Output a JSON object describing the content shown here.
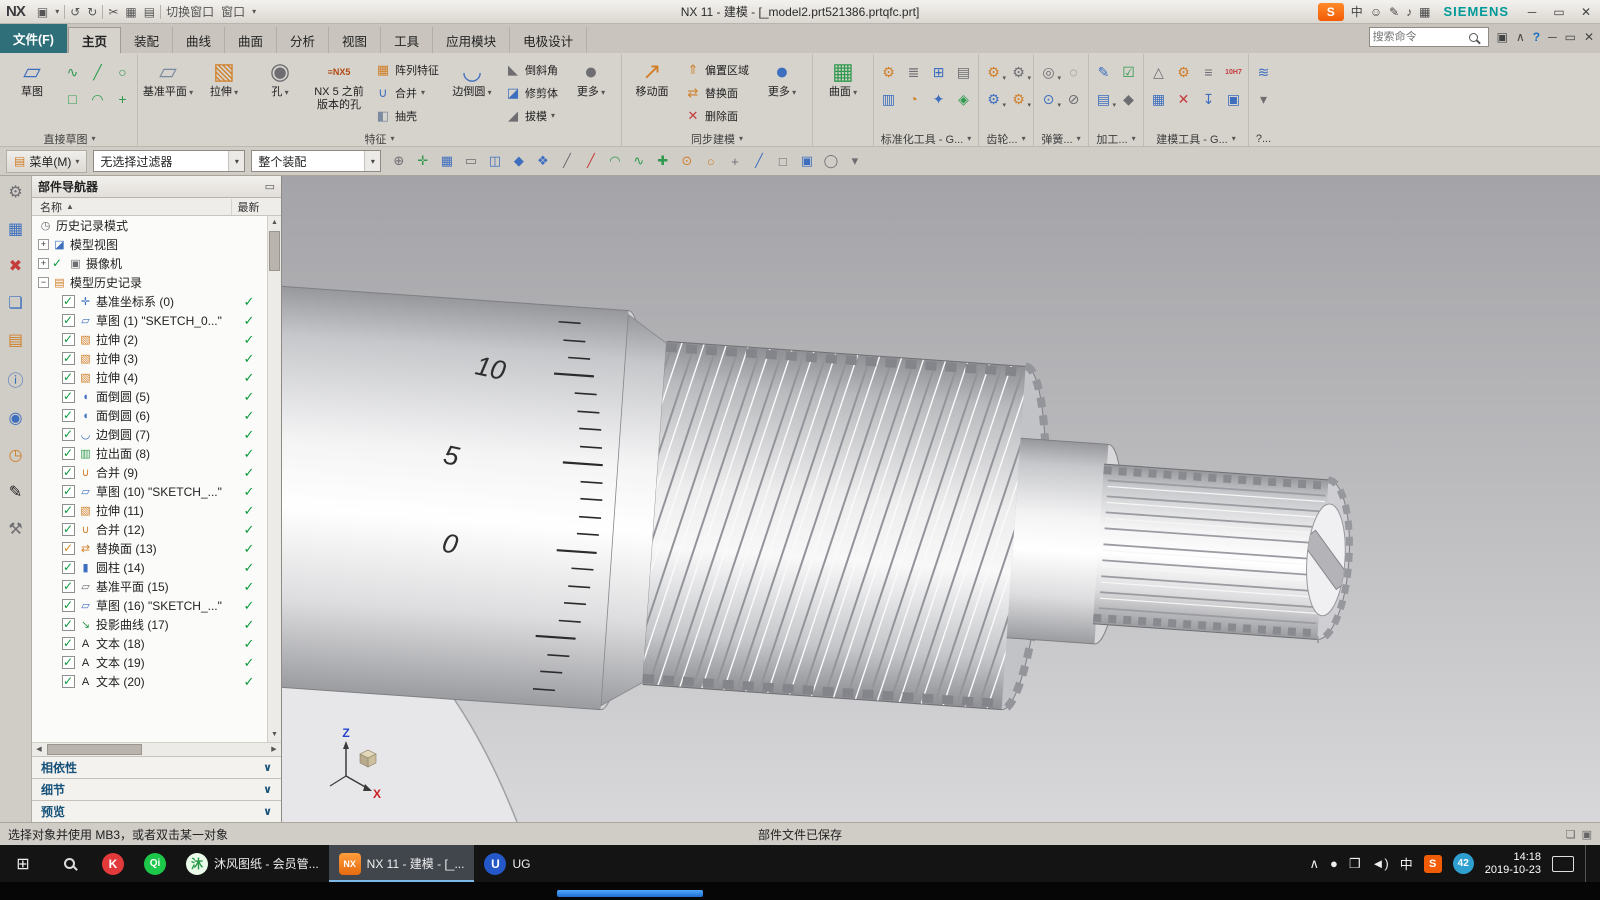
{
  "titlebar": {
    "logo": "NX",
    "title": "NX 11 - 建模 - [_model2.prt521386.prtqfc.prt]",
    "switch_window": "切换窗口",
    "window": "窗口",
    "ime_sogou": "S",
    "ime_lang": "中",
    "brand": "SIEMENS"
  },
  "tabs": {
    "search_placeholder": "搜索命令",
    "items": [
      {
        "label": "文件(F)",
        "c": "t-file"
      },
      {
        "label": "主页",
        "c": "t-active"
      },
      {
        "label": "装配",
        "c": ""
      },
      {
        "label": "曲线",
        "c": ""
      },
      {
        "label": "曲面",
        "c": ""
      },
      {
        "label": "分析",
        "c": ""
      },
      {
        "label": "视图",
        "c": ""
      },
      {
        "label": "工具",
        "c": ""
      },
      {
        "label": "应用模块",
        "c": ""
      },
      {
        "label": "电极设计",
        "c": ""
      }
    ]
  },
  "ribbon": {
    "more": "更多",
    "sketch": {
      "label": "直接草图",
      "main": "草图",
      "tools": [
        {
          "g": "∿",
          "c": "c-grn"
        },
        {
          "g": "□",
          "c": "c-grn"
        },
        {
          "g": "╱",
          "c": "c-grn"
        },
        {
          "g": "◠",
          "c": "c-grn"
        },
        {
          "g": "○",
          "c": "c-grn"
        },
        {
          "g": "+",
          "c": "c-grn"
        }
      ]
    },
    "feature": {
      "label": "特征",
      "datum": "基准平面",
      "extrude": "拉伸",
      "hole": "孔",
      "nx5_icon": "≡NX5",
      "nx5": "NX 5 之前版本的孔",
      "pattern": "阵列特征",
      "unite": "合并",
      "shell": "抽壳",
      "blend": "边倒圆",
      "chamfer": "倒斜角",
      "trim": "修剪体",
      "draft": "拔模"
    },
    "sync": {
      "label": "同步建模",
      "move": "移动面",
      "offset": "偏置区域",
      "replace": "替换面",
      "del": "删除面"
    },
    "surface": {
      "main": "曲面"
    },
    "std": {
      "label": "标准化工具 - G...",
      "icons": [
        {
          "g": "⚙",
          "c": "c-org"
        },
        {
          "g": "▥",
          "c": "c-blu"
        },
        {
          "g": "≣",
          "c": "c-gry"
        },
        {
          "g": "◔",
          "c": "c-org"
        },
        {
          "g": "⊞",
          "c": "c-blu"
        },
        {
          "g": "✦",
          "c": "c-blu"
        },
        {
          "g": "▤",
          "c": "c-gry"
        },
        {
          "g": "◈",
          "c": "c-grn"
        }
      ]
    },
    "gear": {
      "label": "齿轮...",
      "icons": [
        {
          "g": "⚙",
          "c": "c-org dd"
        },
        {
          "g": "⚙",
          "c": "c-blu dd"
        },
        {
          "g": "⚙",
          "c": "c-gry dd"
        },
        {
          "g": "⚙",
          "c": "c-org dd"
        }
      ]
    },
    "spring": {
      "label": "弹簧...",
      "icons": [
        {
          "g": "◎",
          "c": "c-gry dd"
        },
        {
          "g": "⊙",
          "c": "c-blu dd"
        },
        {
          "g": "◌",
          "c": "c-gry"
        },
        {
          "g": "⊘",
          "c": "c-gry"
        }
      ]
    },
    "mach": {
      "label": "加工...",
      "icons": [
        {
          "g": "✎",
          "c": "c-blu"
        },
        {
          "g": "▤",
          "c": "c-blu dd"
        },
        {
          "g": "☑",
          "c": "c-grn"
        },
        {
          "g": "◆",
          "c": "c-gry"
        }
      ]
    },
    "mtools": {
      "label": "建模工具 - G...",
      "icons": [
        {
          "g": "△",
          "c": "c-gry"
        },
        {
          "g": "▦",
          "c": "c-blu"
        },
        {
          "g": "⚙",
          "c": "c-org"
        },
        {
          "g": "✕",
          "c": "c-red"
        },
        {
          "g": "≡",
          "c": "c-gry"
        },
        {
          "g": "↧",
          "c": "c-blu"
        },
        {
          "g": "10H7",
          "c": "c-red txt"
        },
        {
          "g": "▣",
          "c": "c-blu"
        }
      ]
    },
    "extra": {
      "label": "?...",
      "icons": [
        {
          "g": "≋",
          "c": "c-blu"
        },
        {
          "g": "▾",
          "c": "c-gry"
        }
      ]
    }
  },
  "selbar": {
    "menu": "菜单(M)",
    "filter": "无选择过滤器",
    "scope": "整个装配",
    "icons": [
      {
        "g": "⊕",
        "c": "c-gry"
      },
      {
        "g": "✛",
        "c": "c-grn"
      },
      {
        "g": "▦",
        "c": "c-blu"
      },
      {
        "g": "▭",
        "c": "c-gry"
      },
      {
        "g": "◫",
        "c": "c-blu"
      },
      {
        "g": "◆",
        "c": "c-blu"
      },
      {
        "g": "❖",
        "c": "c-blu"
      },
      {
        "g": "╱",
        "c": "c-gry"
      },
      {
        "g": "╱",
        "c": "c-red"
      },
      {
        "g": "◠",
        "c": "c-grn"
      },
      {
        "g": "∿",
        "c": "c-grn"
      },
      {
        "g": "✚",
        "c": "c-grn"
      },
      {
        "g": "⊙",
        "c": "c-org"
      },
      {
        "g": "○",
        "c": "c-org"
      },
      {
        "g": "+",
        "c": "c-gry"
      },
      {
        "g": "╱",
        "c": "c-blu"
      },
      {
        "g": "□",
        "c": "c-gry"
      },
      {
        "g": "▣",
        "c": "c-blu"
      },
      {
        "g": "◯",
        "c": "c-gry"
      },
      {
        "g": "▾",
        "c": "c-gry"
      }
    ]
  },
  "leftstrip": {
    "icons": [
      {
        "g": "⚙",
        "c": "c-gry"
      },
      {
        "g": "▦",
        "c": "c-blu"
      },
      {
        "g": "✖",
        "c": "c-red"
      },
      {
        "g": "❏",
        "c": "c-blu"
      },
      {
        "g": "▤",
        "c": "c-org"
      },
      {
        "g": "ⓘ",
        "c": "c-blu"
      },
      {
        "g": "◉",
        "c": "c-blu"
      },
      {
        "g": "◷",
        "c": "c-org"
      },
      {
        "g": "✎",
        "c": "c-blk"
      },
      {
        "g": "⚒",
        "c": "c-gry"
      }
    ]
  },
  "navigator": {
    "title": "部件导航器",
    "col_name": "名称",
    "col_latest": "最新",
    "rows": [
      {
        "c": "lvl0",
        "exp": "",
        "cb": "",
        "icc": "c-gry",
        "icg": "◷",
        "label": "历史记录模式",
        "lat": ""
      },
      {
        "c": "lvl0",
        "exp": "+",
        "cb": "",
        "icc": "c-blu",
        "icg": "◪",
        "label": "模型视图",
        "lat": ""
      },
      {
        "c": "lvl0",
        "exp": "+",
        "cb": "cb-mark",
        "icc": "c-gry",
        "icg": "▣",
        "label": "摄像机",
        "lat": ""
      },
      {
        "c": "lvl0",
        "exp": "−",
        "cb": "",
        "icc": "c-org",
        "icg": "▤",
        "label": "模型历史记录",
        "lat": ""
      },
      {
        "c": "lvl1",
        "cb": "cb-on",
        "icc": "c-blu",
        "icg": "✛",
        "label": "基准坐标系 (0)",
        "lat": "on"
      },
      {
        "c": "lvl1",
        "cb": "cb-on",
        "icc": "c-blu",
        "icg": "▱",
        "label": "草图 (1) \"SKETCH_0...\"",
        "lat": "on"
      },
      {
        "c": "lvl1",
        "cb": "cb-on",
        "icc": "c-org",
        "icg": "▧",
        "label": "拉伸 (2)",
        "lat": "on"
      },
      {
        "c": "lvl1",
        "cb": "cb-on",
        "icc": "c-org",
        "icg": "▧",
        "label": "拉伸 (3)",
        "lat": "on"
      },
      {
        "c": "lvl1",
        "cb": "cb-on",
        "icc": "c-org",
        "icg": "▧",
        "label": "拉伸 (4)",
        "lat": "on"
      },
      {
        "c": "lvl1",
        "cb": "cb-on",
        "icc": "c-blu",
        "icg": "◖",
        "label": "面倒圆 (5)",
        "lat": "on"
      },
      {
        "c": "lvl1",
        "cb": "cb-on",
        "icc": "c-blu",
        "icg": "◖",
        "label": "面倒圆 (6)",
        "lat": "on"
      },
      {
        "c": "lvl1",
        "cb": "cb-on",
        "icc": "c-blu",
        "icg": "◡",
        "label": "边倒圆 (7)",
        "lat": "on"
      },
      {
        "c": "lvl1",
        "cb": "cb-on",
        "icc": "c-grn",
        "icg": "▥",
        "label": "拉出面 (8)",
        "lat": "on"
      },
      {
        "c": "lvl1",
        "cb": "cb-on",
        "icc": "c-org",
        "icg": "∪",
        "label": "合并 (9)",
        "lat": "on"
      },
      {
        "c": "lvl1",
        "cb": "cb-on",
        "icc": "c-blu",
        "icg": "▱",
        "label": "草图 (10) \"SKETCH_...\"",
        "lat": "on"
      },
      {
        "c": "lvl1",
        "cb": "cb-on",
        "icc": "c-org",
        "icg": "▧",
        "label": "拉伸 (11)",
        "lat": "on"
      },
      {
        "c": "lvl1",
        "cb": "cb-on",
        "icc": "c-org",
        "icg": "∪",
        "label": "合并 (12)",
        "lat": "on"
      },
      {
        "c": "lvl1",
        "cb": "cb-sp",
        "icc": "c-org",
        "icg": "⇄",
        "label": "替换面 (13)",
        "lat": "on"
      },
      {
        "c": "lvl1",
        "cb": "cb-on",
        "icc": "c-blu",
        "icg": "▮",
        "label": "圆柱 (14)",
        "lat": "on"
      },
      {
        "c": "lvl1",
        "cb": "cb-on",
        "icc": "c-gry",
        "icg": "▱",
        "label": "基准平面 (15)",
        "lat": "on"
      },
      {
        "c": "lvl1",
        "cb": "cb-on",
        "icc": "c-blu",
        "icg": "▱",
        "label": "草图 (16) \"SKETCH_...\"",
        "lat": "on"
      },
      {
        "c": "lvl1",
        "cb": "cb-on",
        "icc": "c-grn",
        "icg": "↘",
        "label": "投影曲线 (17)",
        "lat": "on"
      },
      {
        "c": "lvl1",
        "cb": "cb-on",
        "icc": "c-blk",
        "icg": "A",
        "label": "文本 (18)",
        "lat": "on"
      },
      {
        "c": "lvl1",
        "cb": "cb-on",
        "icc": "c-blk",
        "icg": "A",
        "label": "文本 (19)",
        "lat": "on"
      },
      {
        "c": "lvl1",
        "cb": "cb-on",
        "icc": "c-blk",
        "icg": "A",
        "label": "文本 (20)",
        "lat": "on"
      }
    ],
    "sections": [
      {
        "label": "相依性"
      },
      {
        "label": "细节"
      },
      {
        "label": "预览"
      }
    ]
  },
  "viewport": {
    "scale_10": "10",
    "scale_5": "5",
    "scale_0": "0",
    "axis_z": "Z",
    "axis_x": "X"
  },
  "statusbar": {
    "left": "选择对象并使用 MB3，或者双击某一对象",
    "center": "部件文件已保存"
  },
  "taskbar": {
    "apps": [
      {
        "g": "K",
        "c": "ic-k",
        "label": "",
        "active": ""
      },
      {
        "g": "Qi",
        "c": "ic-qy",
        "label": "",
        "active": ""
      },
      {
        "g": "沐",
        "c": "ic-mf",
        "label": "沐风图纸 - 会员管...",
        "active": ""
      },
      {
        "g": "NX",
        "c": "ic-nx",
        "label": "NX 11 - 建模 - [_...",
        "active": "on"
      },
      {
        "g": "U",
        "c": "ic-ug",
        "label": "UG",
        "active": ""
      }
    ],
    "tray": [
      {
        "g": "∧",
        "c": ""
      },
      {
        "g": "●",
        "c": "c-red"
      },
      {
        "g": "❒",
        "c": "c-blu"
      },
      {
        "g": "◄)",
        "c": ""
      },
      {
        "g": "中",
        "c": ""
      },
      {
        "g": "S",
        "c": "tray-sogou"
      }
    ],
    "badge": "42",
    "time": "14:18",
    "date": "2019-10-23"
  }
}
